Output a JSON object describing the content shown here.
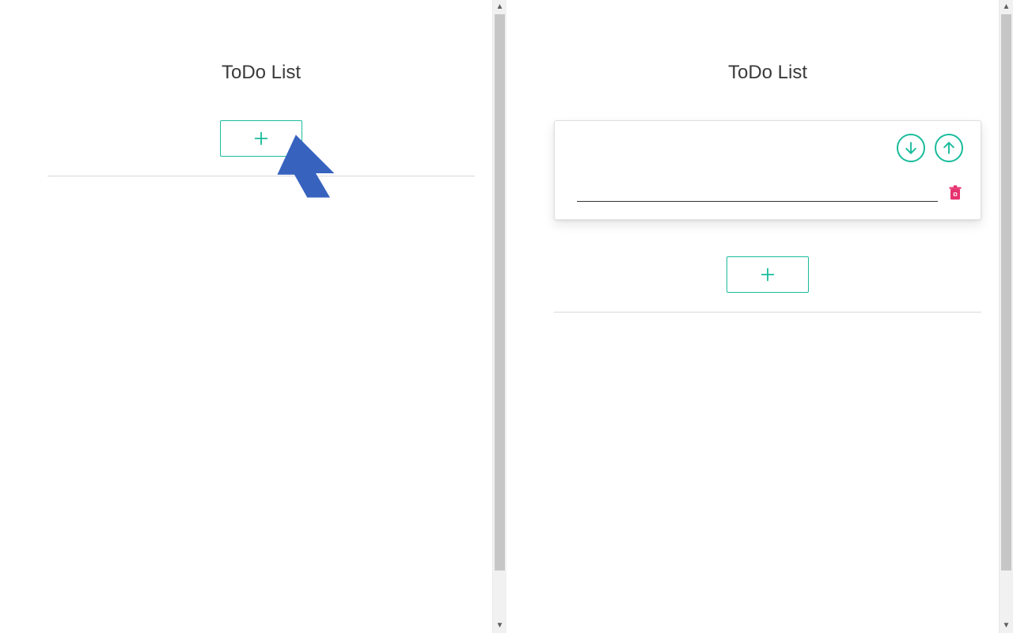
{
  "left": {
    "title": "ToDo List",
    "add_label": "+"
  },
  "right": {
    "title": "ToDo List",
    "add_label": "+",
    "todo_item_value": "",
    "icons": {
      "move_down": "arrow-down-icon",
      "move_up": "arrow-up-icon",
      "delete": "trash-icon",
      "add": "plus-icon"
    }
  },
  "colors": {
    "accent": "#1abc9c",
    "danger": "#e6326e",
    "cursor": "#3763bf"
  }
}
